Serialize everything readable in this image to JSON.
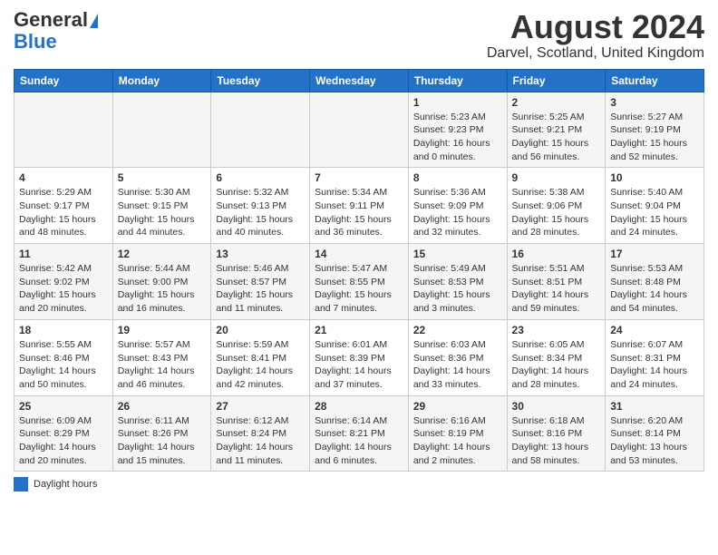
{
  "logo": {
    "line1": "General",
    "line2": "Blue"
  },
  "title": "August 2024",
  "subtitle": "Darvel, Scotland, United Kingdom",
  "days_of_week": [
    "Sunday",
    "Monday",
    "Tuesday",
    "Wednesday",
    "Thursday",
    "Friday",
    "Saturday"
  ],
  "legend_label": "Daylight hours",
  "weeks": [
    [
      {
        "date": "",
        "info": ""
      },
      {
        "date": "",
        "info": ""
      },
      {
        "date": "",
        "info": ""
      },
      {
        "date": "",
        "info": ""
      },
      {
        "date": "1",
        "info": "Sunrise: 5:23 AM\nSunset: 9:23 PM\nDaylight: 16 hours\nand 0 minutes."
      },
      {
        "date": "2",
        "info": "Sunrise: 5:25 AM\nSunset: 9:21 PM\nDaylight: 15 hours\nand 56 minutes."
      },
      {
        "date": "3",
        "info": "Sunrise: 5:27 AM\nSunset: 9:19 PM\nDaylight: 15 hours\nand 52 minutes."
      }
    ],
    [
      {
        "date": "4",
        "info": "Sunrise: 5:29 AM\nSunset: 9:17 PM\nDaylight: 15 hours\nand 48 minutes."
      },
      {
        "date": "5",
        "info": "Sunrise: 5:30 AM\nSunset: 9:15 PM\nDaylight: 15 hours\nand 44 minutes."
      },
      {
        "date": "6",
        "info": "Sunrise: 5:32 AM\nSunset: 9:13 PM\nDaylight: 15 hours\nand 40 minutes."
      },
      {
        "date": "7",
        "info": "Sunrise: 5:34 AM\nSunset: 9:11 PM\nDaylight: 15 hours\nand 36 minutes."
      },
      {
        "date": "8",
        "info": "Sunrise: 5:36 AM\nSunset: 9:09 PM\nDaylight: 15 hours\nand 32 minutes."
      },
      {
        "date": "9",
        "info": "Sunrise: 5:38 AM\nSunset: 9:06 PM\nDaylight: 15 hours\nand 28 minutes."
      },
      {
        "date": "10",
        "info": "Sunrise: 5:40 AM\nSunset: 9:04 PM\nDaylight: 15 hours\nand 24 minutes."
      }
    ],
    [
      {
        "date": "11",
        "info": "Sunrise: 5:42 AM\nSunset: 9:02 PM\nDaylight: 15 hours\nand 20 minutes."
      },
      {
        "date": "12",
        "info": "Sunrise: 5:44 AM\nSunset: 9:00 PM\nDaylight: 15 hours\nand 16 minutes."
      },
      {
        "date": "13",
        "info": "Sunrise: 5:46 AM\nSunset: 8:57 PM\nDaylight: 15 hours\nand 11 minutes."
      },
      {
        "date": "14",
        "info": "Sunrise: 5:47 AM\nSunset: 8:55 PM\nDaylight: 15 hours\nand 7 minutes."
      },
      {
        "date": "15",
        "info": "Sunrise: 5:49 AM\nSunset: 8:53 PM\nDaylight: 15 hours\nand 3 minutes."
      },
      {
        "date": "16",
        "info": "Sunrise: 5:51 AM\nSunset: 8:51 PM\nDaylight: 14 hours\nand 59 minutes."
      },
      {
        "date": "17",
        "info": "Sunrise: 5:53 AM\nSunset: 8:48 PM\nDaylight: 14 hours\nand 54 minutes."
      }
    ],
    [
      {
        "date": "18",
        "info": "Sunrise: 5:55 AM\nSunset: 8:46 PM\nDaylight: 14 hours\nand 50 minutes."
      },
      {
        "date": "19",
        "info": "Sunrise: 5:57 AM\nSunset: 8:43 PM\nDaylight: 14 hours\nand 46 minutes."
      },
      {
        "date": "20",
        "info": "Sunrise: 5:59 AM\nSunset: 8:41 PM\nDaylight: 14 hours\nand 42 minutes."
      },
      {
        "date": "21",
        "info": "Sunrise: 6:01 AM\nSunset: 8:39 PM\nDaylight: 14 hours\nand 37 minutes."
      },
      {
        "date": "22",
        "info": "Sunrise: 6:03 AM\nSunset: 8:36 PM\nDaylight: 14 hours\nand 33 minutes."
      },
      {
        "date": "23",
        "info": "Sunrise: 6:05 AM\nSunset: 8:34 PM\nDaylight: 14 hours\nand 28 minutes."
      },
      {
        "date": "24",
        "info": "Sunrise: 6:07 AM\nSunset: 8:31 PM\nDaylight: 14 hours\nand 24 minutes."
      }
    ],
    [
      {
        "date": "25",
        "info": "Sunrise: 6:09 AM\nSunset: 8:29 PM\nDaylight: 14 hours\nand 20 minutes."
      },
      {
        "date": "26",
        "info": "Sunrise: 6:11 AM\nSunset: 8:26 PM\nDaylight: 14 hours\nand 15 minutes."
      },
      {
        "date": "27",
        "info": "Sunrise: 6:12 AM\nSunset: 8:24 PM\nDaylight: 14 hours\nand 11 minutes."
      },
      {
        "date": "28",
        "info": "Sunrise: 6:14 AM\nSunset: 8:21 PM\nDaylight: 14 hours\nand 6 minutes."
      },
      {
        "date": "29",
        "info": "Sunrise: 6:16 AM\nSunset: 8:19 PM\nDaylight: 14 hours\nand 2 minutes."
      },
      {
        "date": "30",
        "info": "Sunrise: 6:18 AM\nSunset: 8:16 PM\nDaylight: 13 hours\nand 58 minutes."
      },
      {
        "date": "31",
        "info": "Sunrise: 6:20 AM\nSunset: 8:14 PM\nDaylight: 13 hours\nand 53 minutes."
      }
    ]
  ]
}
